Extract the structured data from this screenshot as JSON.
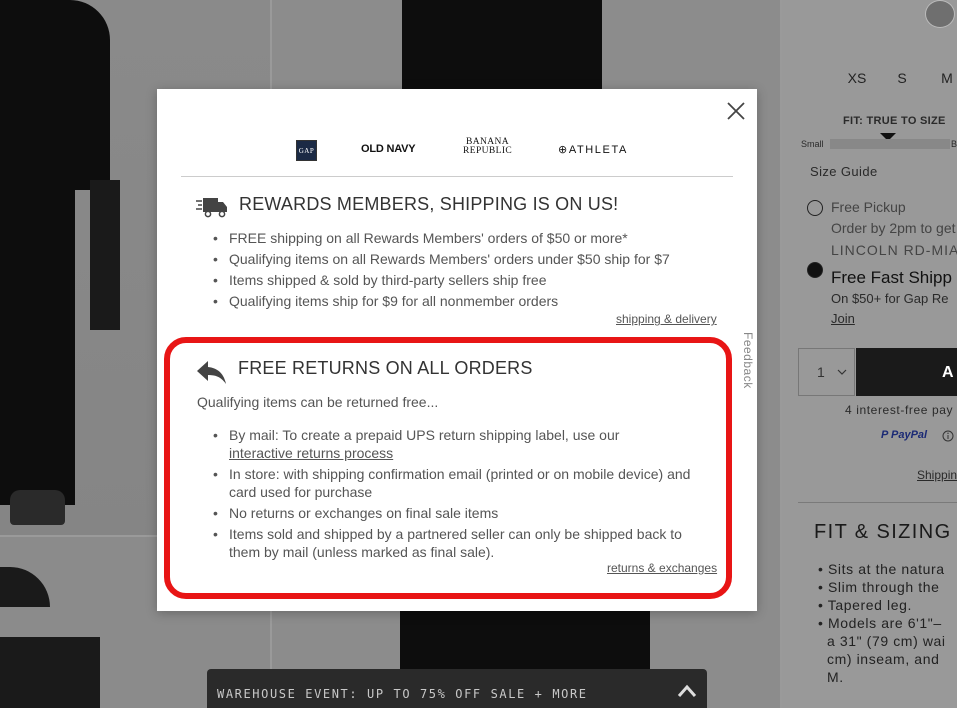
{
  "background": {
    "sizes": [
      "XS",
      "S",
      "M"
    ],
    "fit_label": "FIT: TRUE TO SIZE",
    "fit_small": "Small",
    "fit_big": "B",
    "size_guide": "Size Guide",
    "pickup_label": "Free Pickup",
    "pickup_sub": "Order by 2pm to get",
    "store_name": "LINCOLN RD-MIAM",
    "shipping_label": "Free Fast Shipp",
    "shipping_sub": "On $50+ for Gap Re",
    "join_label": "Join",
    "qty_value": "1",
    "add_label": "A",
    "interest_text": "4 interest-free pay",
    "paypal_label": "PayPal",
    "shipping_link": "Shippin",
    "fit_sizing_title": "FIT & SIZING",
    "fit_bullets": [
      "• Sits at the natura",
      "• Slim through the",
      "• Tapered leg.",
      "• Models are 6'1\"–",
      "  a 31\" (79 cm) wai",
      "  cm) inseam, and",
      "  M."
    ]
  },
  "banner": {
    "text": "WAREHOUSE EVENT: UP TO 75% OFF SALE + MORE"
  },
  "modal": {
    "brands": {
      "gap": "GAP",
      "old_navy": "OLD NAVY",
      "banana_line1": "BANANA",
      "banana_line2": "REPUBLIC",
      "athleta": "ATHLETA"
    },
    "shipping": {
      "title": "REWARDS MEMBERS, SHIPPING IS ON US!",
      "items": [
        "FREE shipping on all Rewards Members' orders of $50 or more*",
        "Qualifying items on all Rewards Members' orders under $50 ship for $7",
        "Items shipped & sold by third-party sellers ship free",
        "Qualifying items ship for $9 for all nonmember orders"
      ],
      "link": "shipping & delivery"
    },
    "returns": {
      "title": "FREE RETURNS ON ALL ORDERS",
      "intro": "Qualifying items can be returned free...",
      "item1_prefix": "By mail: To create a prepaid UPS return shipping label, use our",
      "item1_link": "interactive returns process",
      "item2": "In store: with shipping confirmation email (printed or on mobile device) and card used for purchase",
      "item3": "No returns or exchanges on final sale items",
      "item4": "Items sold and shipped by a partnered seller can only be shipped back to them by mail (unless marked as final sale).",
      "link": "returns & exchanges"
    },
    "feedback": "Feedback"
  },
  "colors": {
    "highlight": "#e81515",
    "overlay_bg": "#9a9a9a",
    "banner_bg": "#2a2a2a"
  },
  "icons": [
    "close-icon",
    "truck-icon",
    "return-arrow-icon",
    "chevron-up-icon",
    "chevron-down-icon",
    "paypal-icon",
    "info-icon"
  ]
}
